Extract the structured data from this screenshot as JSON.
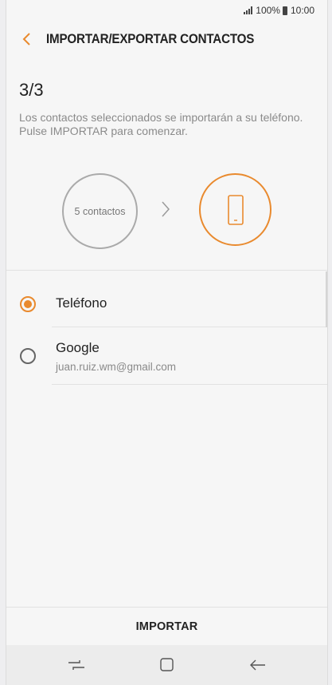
{
  "status_bar": {
    "battery": "100%",
    "time": "10:00"
  },
  "header": {
    "back_icon": "chevron-left-icon",
    "title": "IMPORTAR/EXPORTAR CONTACTOS"
  },
  "wizard": {
    "step": "3/3",
    "description": "Los contactos seleccionados se importarán a su teléfono. Pulse IMPORTAR para comenzar.",
    "source_label": "5 contactos",
    "arrow_icon": "chevron-right-icon",
    "destination_icon": "phone-icon"
  },
  "options": [
    {
      "label": "Teléfono",
      "sublabel": "",
      "selected": true
    },
    {
      "label": "Google",
      "sublabel": "juan.ruiz.wm@gmail.com",
      "selected": false
    }
  ],
  "footer": {
    "import_label": "IMPORTAR"
  },
  "nav_bar": {
    "recents_icon": "recents-icon",
    "home_icon": "home-icon",
    "back_icon": "back-arrow-icon"
  },
  "colors": {
    "accent": "#e98a2e",
    "background": "#f6f6f6"
  }
}
